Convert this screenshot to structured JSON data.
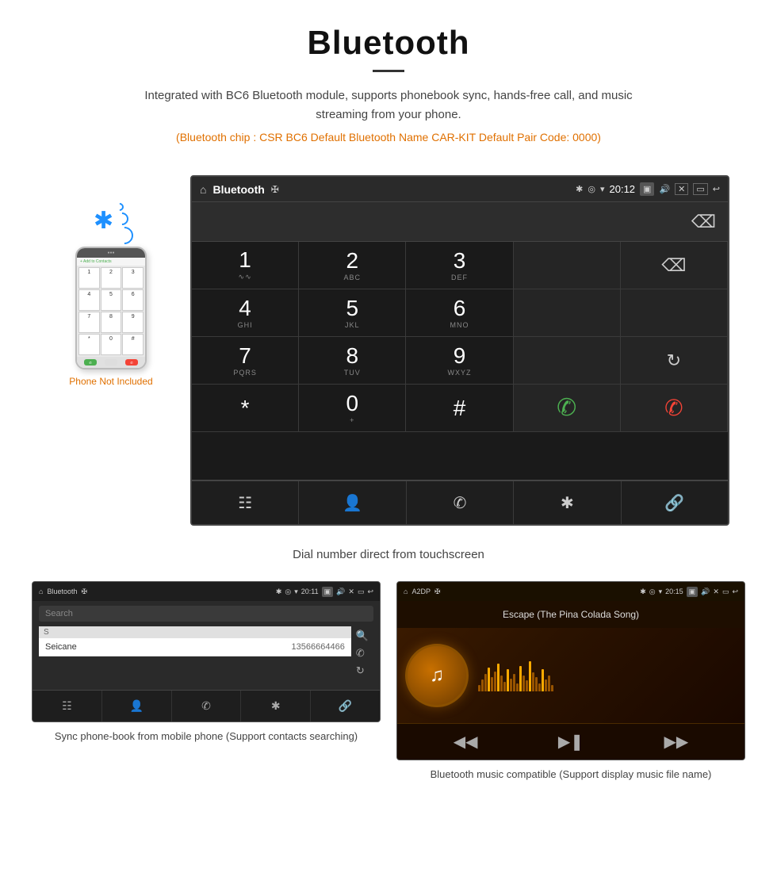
{
  "header": {
    "title": "Bluetooth",
    "description": "Integrated with BC6 Bluetooth module, supports phonebook sync, hands-free call, and music streaming from your phone.",
    "specs": "(Bluetooth chip : CSR BC6    Default Bluetooth Name CAR-KIT    Default Pair Code: 0000)"
  },
  "phone_side": {
    "not_included": "Phone Not Included"
  },
  "car_screen": {
    "title": "Bluetooth",
    "time": "20:12",
    "status_icons": [
      "✱",
      "◎",
      "▾"
    ],
    "nav_icons": [
      "⊞",
      "👤",
      "☎",
      "✱",
      "🔗"
    ],
    "dial_keys": [
      {
        "number": "1",
        "letters": "∿∿"
      },
      {
        "number": "2",
        "letters": "ABC"
      },
      {
        "number": "3",
        "letters": "DEF"
      },
      {
        "number": "4",
        "letters": "GHI"
      },
      {
        "number": "5",
        "letters": "JKL"
      },
      {
        "number": "6",
        "letters": "MNO"
      },
      {
        "number": "7",
        "letters": "PQRS"
      },
      {
        "number": "8",
        "letters": "TUV"
      },
      {
        "number": "9",
        "letters": "WXYZ"
      },
      {
        "number": "*",
        "letters": ""
      },
      {
        "number": "0",
        "letters": "+"
      },
      {
        "number": "#",
        "letters": ""
      }
    ]
  },
  "main_caption": "Dial number direct from touchscreen",
  "phonebook_screen": {
    "title": "Bluetooth",
    "time": "20:11",
    "search_placeholder": "Search",
    "section_letter": "S",
    "contact_name": "Seicane",
    "contact_number": "13566664466"
  },
  "music_screen": {
    "title": "A2DP",
    "time": "20:15",
    "song_title": "Escape (The Pina Colada Song)"
  },
  "captions": {
    "phonebook": "Sync phone-book from mobile phone\n(Support contacts searching)",
    "music": "Bluetooth music compatible\n(Support display music file name)"
  }
}
